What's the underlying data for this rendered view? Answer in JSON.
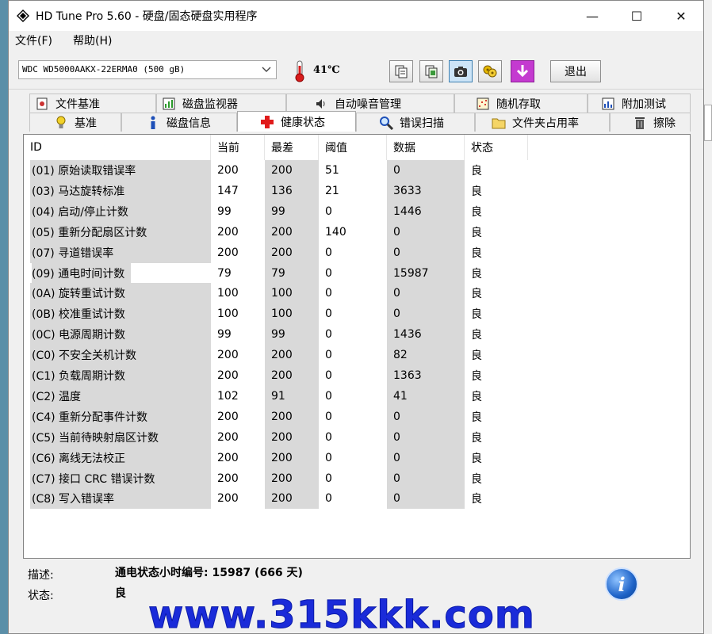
{
  "window": {
    "title": "HD Tune Pro 5.60 - 硬盘/固态硬盘实用程序",
    "minimize_symbol": "—",
    "maximize_symbol": "☐",
    "close_symbol": "✕"
  },
  "menu": {
    "items": [
      "文件(F)",
      "帮助(H)"
    ]
  },
  "toolbar": {
    "drive": "WDC WD5000AAKX-22ERMA0 (500 gB)",
    "temperature": "41℃",
    "exit_label": "退出",
    "buttons": [
      "copy-text-icon",
      "copy-screenshot-icon",
      "camera-icon",
      "options-icon",
      "save-down-icon"
    ]
  },
  "tabs": {
    "row1": [
      "文件基准",
      "磁盘监视器",
      "自动噪音管理",
      "随机存取",
      "附加测试"
    ],
    "row2": [
      "基准",
      "磁盘信息",
      "健康状态",
      "错误扫描",
      "文件夹占用率",
      "擦除"
    ],
    "selected": "健康状态"
  },
  "table": {
    "headers": [
      "ID",
      "当前",
      "最差",
      "阈值",
      "数据",
      "状态"
    ],
    "rows": [
      [
        "(01) 原始读取错误率",
        "200",
        "200",
        "51",
        "0",
        "良"
      ],
      [
        "(03) 马达旋转标准",
        "147",
        "136",
        "21",
        "3633",
        "良"
      ],
      [
        "(04) 启动/停止计数",
        "99",
        "99",
        "0",
        "1446",
        "良"
      ],
      [
        "(05) 重新分配扇区计数",
        "200",
        "200",
        "140",
        "0",
        "良"
      ],
      [
        "(07) 寻道错误率",
        "200",
        "200",
        "0",
        "0",
        "良"
      ],
      [
        "(09) 通电时间计数",
        "79",
        "79",
        "0",
        "15987",
        "良"
      ],
      [
        "(0A) 旋转重试计数",
        "100",
        "100",
        "0",
        "0",
        "良"
      ],
      [
        "(0B) 校准重试计数",
        "100",
        "100",
        "0",
        "0",
        "良"
      ],
      [
        "(0C) 电源周期计数",
        "99",
        "99",
        "0",
        "1436",
        "良"
      ],
      [
        "(C0) 不安全关机计数",
        "200",
        "200",
        "0",
        "82",
        "良"
      ],
      [
        "(C1) 负载周期计数",
        "200",
        "200",
        "0",
        "1363",
        "良"
      ],
      [
        "(C2) 温度",
        "102",
        "91",
        "0",
        "41",
        "良"
      ],
      [
        "(C4) 重新分配事件计数",
        "200",
        "200",
        "0",
        "0",
        "良"
      ],
      [
        "(C5) 当前待映射扇区计数",
        "200",
        "200",
        "0",
        "0",
        "良"
      ],
      [
        "(C6) 离线无法校正",
        "200",
        "200",
        "0",
        "0",
        "良"
      ],
      [
        "(C7) 接口 CRC 错误计数",
        "200",
        "200",
        "0",
        "0",
        "良"
      ],
      [
        "(C8) 写入错误率",
        "200",
        "200",
        "0",
        "0",
        "良"
      ]
    ],
    "selected_row": 5
  },
  "footer": {
    "description_label": "描述:",
    "description_value": "通电状态小时编号: 15987 (666 天)",
    "status_label": "状态:",
    "status_value": "良"
  },
  "watermark": "www.315kkk.com",
  "colors": {
    "accent": "#1e63c8",
    "watermark": "#1a2bd9",
    "grid_shade": "#d9d9d9"
  }
}
